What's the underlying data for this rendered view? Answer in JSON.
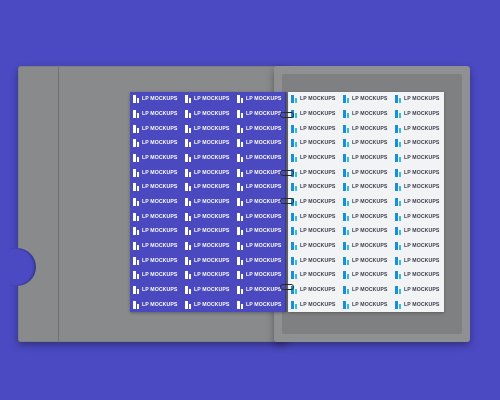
{
  "mockup": {
    "brand_text": "LP MOCKUPS",
    "colors": {
      "background": "#4b4ac2",
      "box": "#888a8c",
      "left_page": "#4a49c0",
      "right_page": "#f2f3f5",
      "logo_blue": "#1a8fd6",
      "logo_cyan": "#2ec0e0"
    },
    "left_page": {
      "rows": 15,
      "columns": 3
    },
    "right_page": {
      "rows": 15,
      "columns": 3
    },
    "rings": 4
  }
}
